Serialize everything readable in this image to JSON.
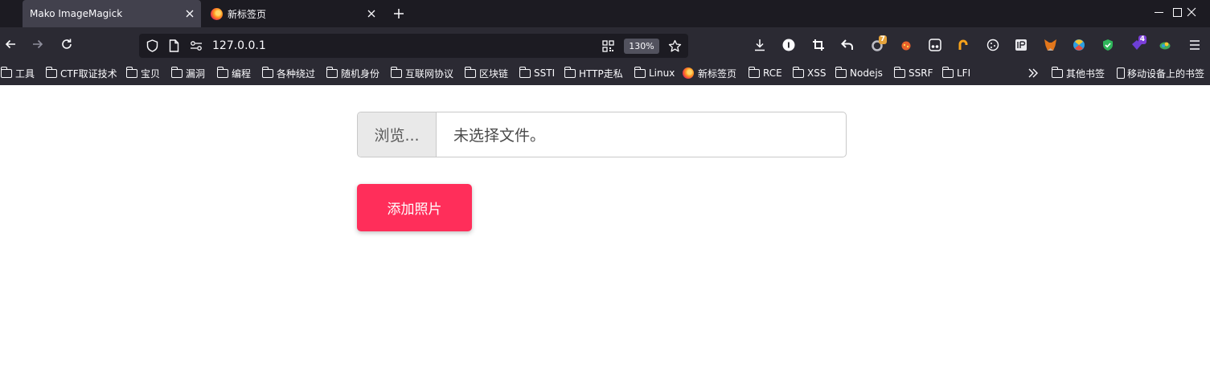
{
  "tabs": [
    {
      "title": "Mako ImageMagick",
      "active": true
    },
    {
      "title": "新标签页",
      "active": false
    }
  ],
  "navbar": {
    "url": "127.0.0.1",
    "zoom": "130%"
  },
  "extensions": [
    {
      "name": "download-icon"
    },
    {
      "name": "1password-icon",
      "badge": ""
    },
    {
      "name": "crop-icon"
    },
    {
      "name": "undo-icon"
    },
    {
      "name": "extension-ring-icon",
      "badge": "7",
      "badge_color": "#e5a33b"
    },
    {
      "name": "extension-bug-icon"
    },
    {
      "name": "extension-glasses-icon"
    },
    {
      "name": "extension-hook-icon"
    },
    {
      "name": "cookie-icon"
    },
    {
      "name": "ip-icon"
    },
    {
      "name": "metamask-icon"
    },
    {
      "name": "extension-globe-icon"
    },
    {
      "name": "shield-check-icon"
    },
    {
      "name": "extension-gem-icon",
      "badge": "4",
      "badge_color": "#7a3dd8"
    },
    {
      "name": "extension-leaf-icon"
    }
  ],
  "bookmarks": [
    {
      "label": "工具",
      "type": "folder"
    },
    {
      "label": "CTF取证技术",
      "type": "folder"
    },
    {
      "label": "宝贝",
      "type": "folder"
    },
    {
      "label": "漏洞",
      "type": "folder"
    },
    {
      "label": "编程",
      "type": "folder"
    },
    {
      "label": "各种绕过",
      "type": "folder"
    },
    {
      "label": "随机身份",
      "type": "folder"
    },
    {
      "label": "互联网协议",
      "type": "folder"
    },
    {
      "label": "区块链",
      "type": "folder"
    },
    {
      "label": "SSTI",
      "type": "folder"
    },
    {
      "label": "HTTP走私",
      "type": "folder"
    },
    {
      "label": "Linux",
      "type": "folder"
    },
    {
      "label": "新标签页",
      "type": "firefox"
    },
    {
      "label": "RCE",
      "type": "folder"
    },
    {
      "label": "XSS",
      "type": "folder"
    },
    {
      "label": "Nodejs",
      "type": "folder"
    },
    {
      "label": "SSRF",
      "type": "folder"
    },
    {
      "label": "LFI",
      "type": "folder"
    }
  ],
  "bookmarks_right": {
    "other": "其他书签",
    "mobile": "移动设备上的书签"
  },
  "page": {
    "browse_label": "浏览...",
    "file_status": "未选择文件。",
    "submit_label": "添加照片"
  },
  "colors": {
    "submit_button": "#ff2e5a",
    "tab_strip": "#1c1b22",
    "toolbar": "#2b2a33"
  }
}
